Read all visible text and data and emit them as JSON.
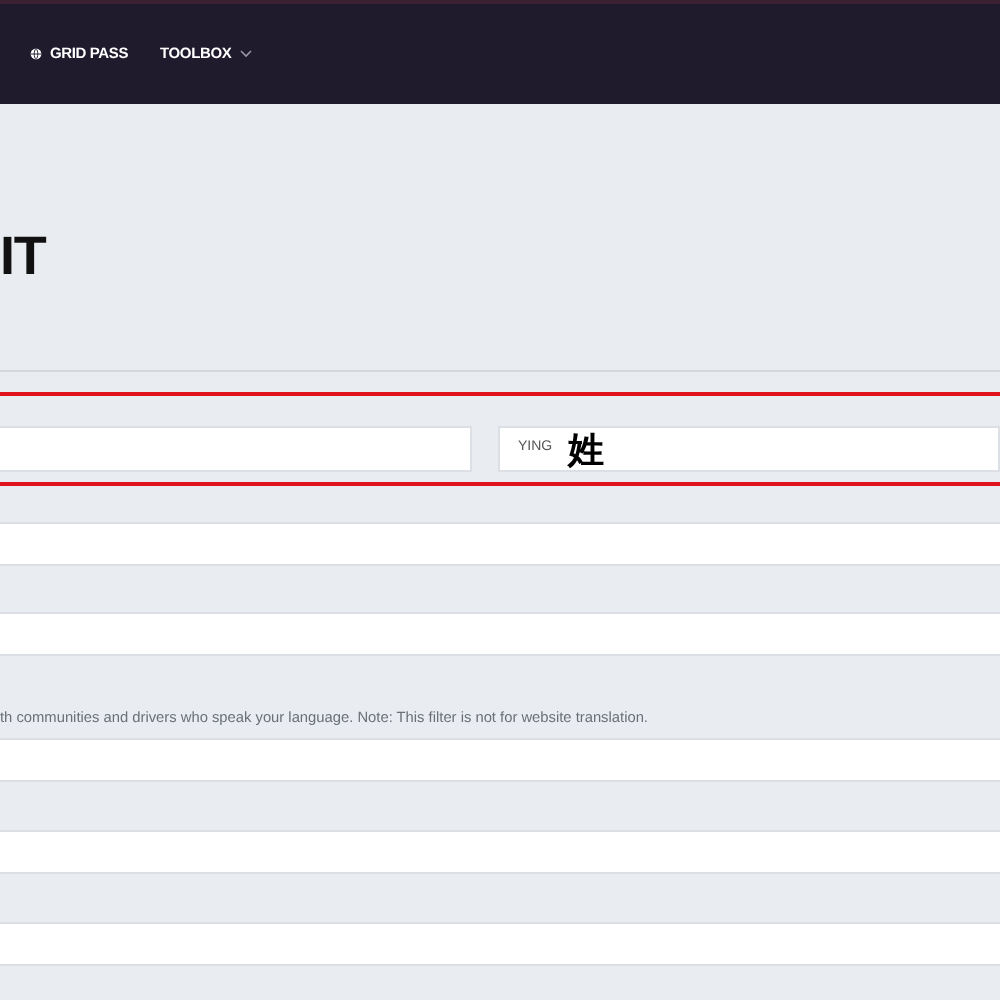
{
  "nav": {
    "items": [
      {
        "kind": "globe",
        "label": "GRID PASS"
      },
      {
        "kind": "dropdown",
        "label": "TOOLBOX"
      }
    ]
  },
  "heading": "IT",
  "name_fields": [
    {
      "kind": "input"
    },
    {
      "kind": "prefixed",
      "prefix": "YING",
      "annotation": "姓"
    }
  ],
  "fields_before_note": [
    {
      "kind": "input"
    },
    {
      "kind": "input"
    }
  ],
  "note": "th communities and drivers who speak your language. Note: This filter is not for website translation.",
  "fields_after_note": [
    {
      "kind": "input"
    },
    {
      "kind": "input"
    },
    {
      "kind": "input"
    }
  ]
}
